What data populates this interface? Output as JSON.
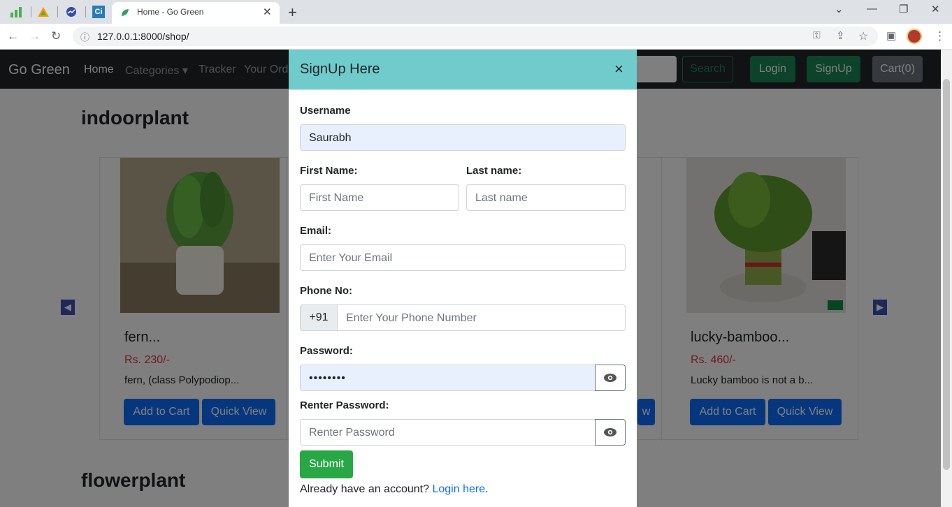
{
  "browser": {
    "tab_title": "Home - Go Green",
    "url": "127.0.0.1:8000/shop/",
    "pinned_icons": [
      "bar-chart-icon",
      "triangle-logo-icon",
      "analytics-logo-icon",
      "ci-logo-icon"
    ]
  },
  "navbar": {
    "brand": "Go Green",
    "links": [
      "Home",
      "Categories",
      "Tracker",
      "Your Ord"
    ],
    "search_button": "Search",
    "login": "Login",
    "signup": "SignUp",
    "cart": "Cart(0)"
  },
  "sections": {
    "indoor": "indoorplant",
    "flower": "flowerplant"
  },
  "products": [
    {
      "title": "fern...",
      "price": "Rs. 230/-",
      "desc": "fern, (class Polypodiop...",
      "add": "Add to Cart",
      "view": "Quick View"
    },
    {
      "title": "lucky-bamboo...",
      "price": "Rs. 460/-",
      "desc": "Lucky bamboo is not a b...",
      "add": "Add to Cart",
      "view": "Quick View"
    }
  ],
  "partial_button": "w",
  "modal": {
    "title": "SignUp Here",
    "close": "×",
    "username_label": "Username",
    "username_value": "Saurabh",
    "first_label": "First Name:",
    "first_placeholder": "First Name",
    "last_label": "Last name:",
    "last_placeholder": "Last name",
    "email_label": "Email:",
    "email_placeholder": "Enter Your Email",
    "phone_label": "Phone No:",
    "phone_prefix": "+91",
    "phone_placeholder": "Enter Your Phone Number",
    "password_label": "Password:",
    "password_value": "••••••••",
    "repassword_label": "Renter Password:",
    "repassword_placeholder": "Renter Password",
    "submit": "Submit",
    "footer_text": "Already have an account?",
    "footer_link": "Login here",
    "footer_end": "."
  }
}
